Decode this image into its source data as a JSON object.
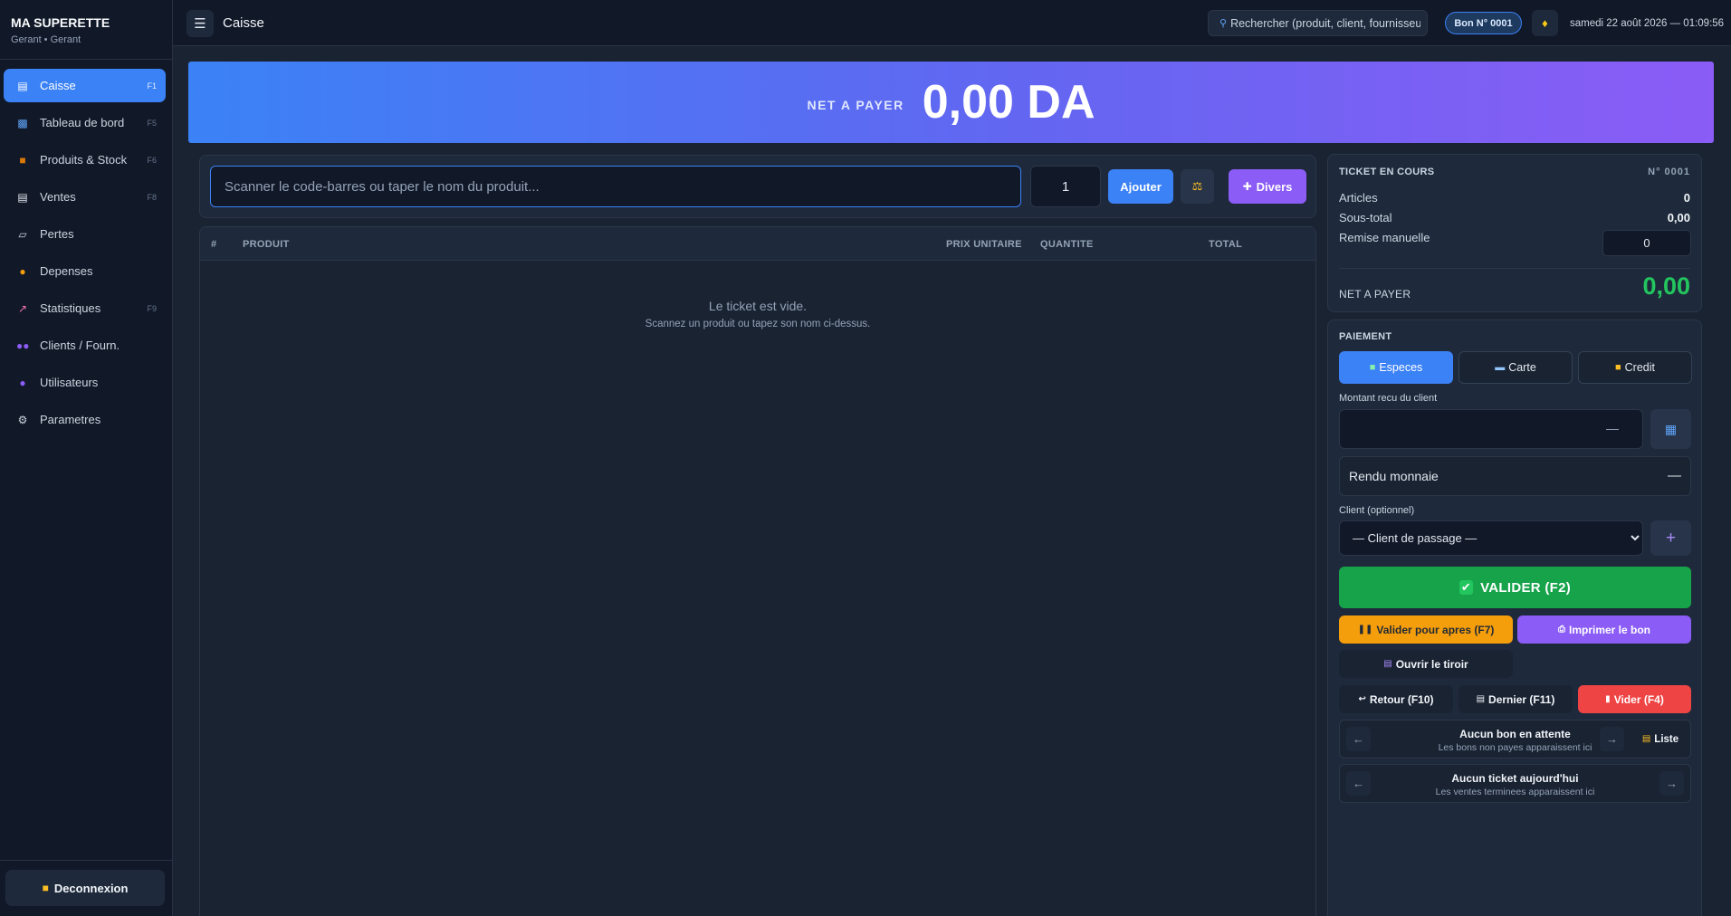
{
  "brand": {
    "name": "MA SUPERETTE",
    "subtitle": "Gerant • Gerant"
  },
  "sidebar": {
    "items": [
      {
        "label": "Caisse",
        "key": "F1",
        "icon": "register-icon"
      },
      {
        "label": "Tableau de bord",
        "key": "F5",
        "icon": "chart-icon"
      },
      {
        "label": "Produits & Stock",
        "key": "F6",
        "icon": "box-icon"
      },
      {
        "label": "Ventes",
        "key": "F8",
        "icon": "receipt-icon"
      },
      {
        "label": "Pertes",
        "key": "",
        "icon": "trash-icon"
      },
      {
        "label": "Depenses",
        "key": "",
        "icon": "money-bag-icon"
      },
      {
        "label": "Statistiques",
        "key": "F9",
        "icon": "trend-icon"
      },
      {
        "label": "Clients / Fourn.",
        "key": "",
        "icon": "users-icon"
      },
      {
        "label": "Utilisateurs",
        "key": "",
        "icon": "user-icon"
      },
      {
        "label": "Parametres",
        "key": "",
        "icon": "gear-icon"
      }
    ],
    "logout": "Deconnexion"
  },
  "topbar": {
    "title": "Caisse",
    "search_placeholder": "Rechercher (produit, client, fournisseur...)",
    "bon_badge": "Bon N° 0001",
    "datetime": "samedi 22 août 2026 — 01:09:56"
  },
  "banner": {
    "label": "NET A PAYER",
    "value": "0,00 DA"
  },
  "scanner": {
    "placeholder": "Scanner le code-barres ou taper le nom du produit...",
    "quantity": "1",
    "add_label": "Ajouter",
    "divers_label": "Divers"
  },
  "table": {
    "headers": {
      "num": "#",
      "product": "PRODUIT",
      "unit_price": "PRIX UNITAIRE",
      "quantity": "QUANTITE",
      "total": "TOTAL"
    },
    "empty_title": "Le ticket est vide.",
    "empty_sub": "Scannez un produit ou tapez son nom ci-dessus."
  },
  "ticket": {
    "title": "TICKET EN COURS",
    "number": "N° 0001",
    "articles_label": "Articles",
    "articles_value": "0",
    "subtotal_label": "Sous-total",
    "subtotal_value": "0,00",
    "discount_label": "Remise manuelle",
    "discount_value": "0",
    "net_label": "NET A PAYER",
    "net_value": "0,00"
  },
  "payment": {
    "title": "PAIEMENT",
    "methods": [
      {
        "label": "Especes",
        "icon": "cash-icon"
      },
      {
        "label": "Carte",
        "icon": "card-icon"
      },
      {
        "label": "Credit",
        "icon": "note-icon"
      }
    ],
    "amount_label": "Montant recu du client",
    "amount_dash": "—",
    "change_label": "Rendu monnaie",
    "change_value": "—",
    "client_label": "Client (optionnel)",
    "client_selected": "— Client de passage —",
    "validate": "VALIDER (F2)",
    "validate_later": "Valider pour apres (F7)",
    "print": "Imprimer le bon",
    "open_drawer": "Ouvrir le tiroir",
    "return": "Retour (F10)",
    "last": "Dernier (F11)",
    "clear": "Vider (F4)",
    "hold_title": "Aucun bon en attente",
    "hold_sub": "Les bons non payes apparaissent ici",
    "list_label": "Liste",
    "today_title": "Aucun ticket aujourd'hui",
    "today_sub": "Les ventes terminees apparaissent ici"
  },
  "colors": {
    "accent": "#3b82f6",
    "success": "#16a34a",
    "warning": "#f59e0b",
    "purple": "#8b5cf6",
    "danger": "#ef4444"
  }
}
